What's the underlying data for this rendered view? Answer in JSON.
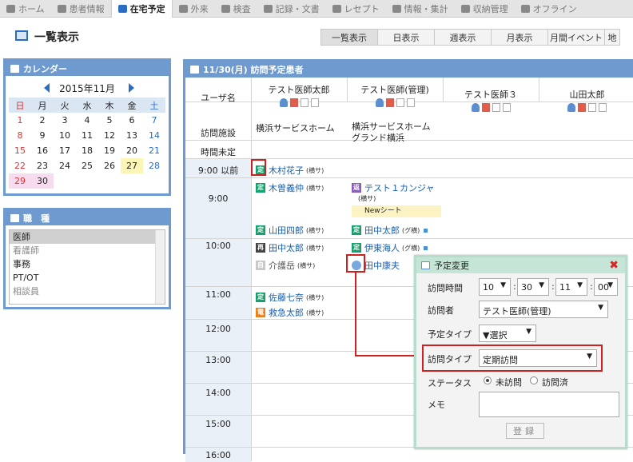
{
  "topnav": [
    {
      "label": "ホーム",
      "icon": "home-icon"
    },
    {
      "label": "患者情報",
      "icon": "patients-icon"
    },
    {
      "label": "在宅予定",
      "icon": "clock-icon",
      "active": true
    },
    {
      "label": "外来",
      "icon": "outpatient-icon"
    },
    {
      "label": "検査",
      "icon": "test-icon"
    },
    {
      "label": "記録・文書",
      "icon": "document-icon"
    },
    {
      "label": "レセプト",
      "icon": "receipt-icon"
    },
    {
      "label": "情報・集計",
      "icon": "stats-icon"
    },
    {
      "label": "収納管理",
      "icon": "payment-icon"
    },
    {
      "label": "オフライン",
      "icon": "offline-icon"
    }
  ],
  "page": {
    "title": "一覧表示"
  },
  "viewtabs": [
    "一覧表示",
    "日表示",
    "週表示",
    "月表示",
    "月間イベント",
    "地"
  ],
  "calendar": {
    "title": "カレンダー",
    "month": "2015年11月",
    "weekdays": [
      "日",
      "月",
      "火",
      "水",
      "木",
      "金",
      "土"
    ],
    "weeks": [
      [
        "1",
        "2",
        "3",
        "4",
        "5",
        "6",
        "7"
      ],
      [
        "8",
        "9",
        "10",
        "11",
        "12",
        "13",
        "14"
      ],
      [
        "15",
        "16",
        "17",
        "18",
        "19",
        "20",
        "21"
      ],
      [
        "22",
        "23",
        "24",
        "25",
        "26",
        "27",
        "28"
      ],
      [
        "29",
        "30",
        "",
        "",
        "",
        "",
        ""
      ]
    ]
  },
  "kind": {
    "title": "職　種",
    "items": [
      "医師",
      "看護師",
      "事務",
      "PT/OT",
      "相談員"
    ]
  },
  "schedule": {
    "title": "11/30(月) 訪問予定患者",
    "user_label": "ユーザ名",
    "facility_label": "訪問施設",
    "undecided_label": "時間未定",
    "users": [
      "テスト医師太郎",
      "テスト医師(管理)",
      "テスト医師３",
      "山田太郎"
    ],
    "facilities": [
      "横浜サービスホーム",
      "横浜サービスホーム\nグランド横浜"
    ],
    "times": [
      "9:00 以前",
      "9:00",
      "10:00",
      "11:00",
      "12:00",
      "13:00",
      "14:00",
      "15:00",
      "16:00"
    ],
    "entries": {
      "e1": {
        "badge": "定",
        "name": "木村花子",
        "suffix": "(横サ)"
      },
      "e2": {
        "badge": "定",
        "name": "木曽義仲",
        "suffix": "(横サ)"
      },
      "e3": {
        "badge": "返",
        "name": "テスト１カンジャ",
        "suffix": "(横サ)",
        "note": "Newシート"
      },
      "e4": {
        "badge": "定",
        "name": "山田四郎",
        "suffix": "(横サ)"
      },
      "e5": {
        "badge": "定",
        "name": "田中太郎",
        "suffix": "(グ横)"
      },
      "e6": {
        "badge": "再",
        "name": "田中太郎",
        "suffix": "(横サ)"
      },
      "e7": {
        "badge": "定",
        "name": "伊東海人",
        "suffix": "(グ横)"
      },
      "e8": {
        "badge": "自",
        "name": "介護岳",
        "suffix": "(横サ)"
      },
      "e9": {
        "name": "田中康夫"
      },
      "e10": {
        "badge": "定",
        "name": "佐藤七奈",
        "suffix": "(横サ)"
      },
      "e11": {
        "badge": "電",
        "name": "救急太郎",
        "suffix": "(横サ)"
      }
    }
  },
  "dialog": {
    "title": "予定変更",
    "time_label": "訪問時間",
    "time_values": [
      "10",
      "30",
      "11",
      "00"
    ],
    "visitor_label": "訪問者",
    "visitor_value": "テスト医師(管理)",
    "type_label": "予定タイプ",
    "type_value": "▼選択",
    "visittype_label": "訪問タイプ",
    "visittype_value": "定期訪問",
    "status_label": "ステータス",
    "status_opt1": "未訪問",
    "status_opt2": "訪問済",
    "memo_label": "メモ",
    "register_label": "登録"
  }
}
